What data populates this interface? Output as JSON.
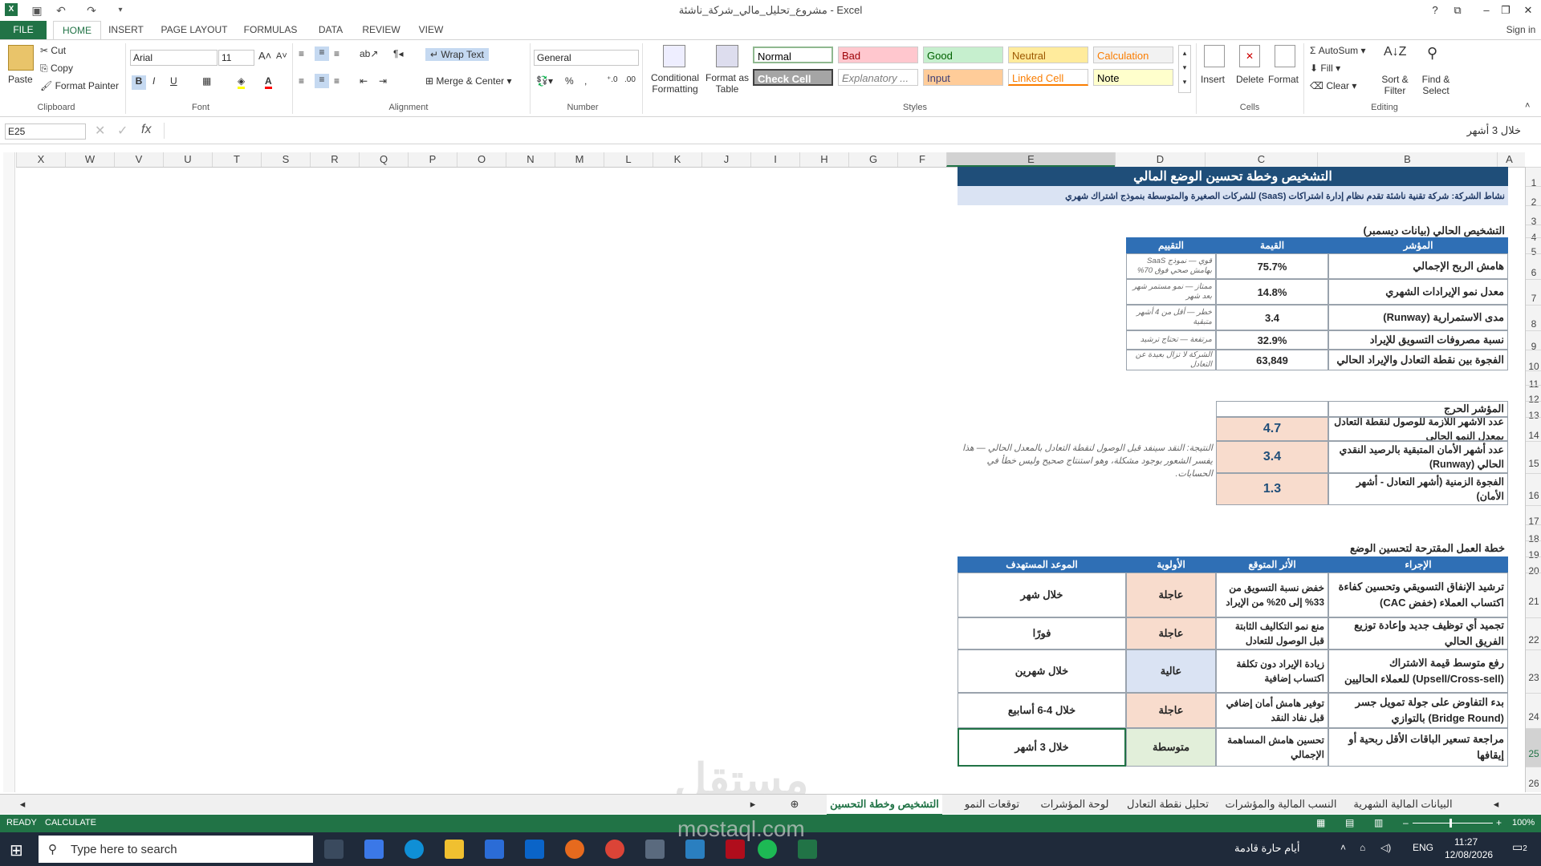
{
  "window": {
    "title": "مشروع_تحليل_مالي_شركة_ناشئة - Excel",
    "help": "?",
    "sign_in": "Sign in"
  },
  "ribbon_tabs": [
    "FILE",
    "HOME",
    "INSERT",
    "PAGE LAYOUT",
    "FORMULAS",
    "DATA",
    "REVIEW",
    "VIEW"
  ],
  "clipboard": {
    "paste": "Paste",
    "cut": "Cut",
    "copy": "Copy",
    "format_painter": "Format Painter",
    "label": "Clipboard"
  },
  "font": {
    "name": "Arial",
    "size": "11",
    "label": "Font"
  },
  "alignment": {
    "wrap": "Wrap Text",
    "merge": "Merge & Center",
    "label": "Alignment"
  },
  "number": {
    "format": "General",
    "label": "Number"
  },
  "styles": {
    "conditional": "Conditional Formatting",
    "format_table": "Format as Table",
    "label": "Styles",
    "cells": [
      {
        "name": "Normal",
        "bg": "#ffffff",
        "fg": "#000000"
      },
      {
        "name": "Bad",
        "bg": "#ffc7ce",
        "fg": "#9c0006"
      },
      {
        "name": "Good",
        "bg": "#c6efce",
        "fg": "#006100"
      },
      {
        "name": "Neutral",
        "bg": "#ffeb9c",
        "fg": "#9c5700"
      },
      {
        "name": "Calculation",
        "bg": "#f2f2f2",
        "fg": "#fa7d00"
      },
      {
        "name": "Check Cell",
        "bg": "#a5a5a5",
        "fg": "#ffffff"
      },
      {
        "name": "Explanatory ...",
        "bg": "#ffffff",
        "fg": "#7f7f7f"
      },
      {
        "name": "Input",
        "bg": "#ffcc99",
        "fg": "#3f3f76"
      },
      {
        "name": "Linked Cell",
        "bg": "#ffffff",
        "fg": "#fa7d00"
      },
      {
        "name": "Note",
        "bg": "#ffffcc",
        "fg": "#000000"
      }
    ]
  },
  "cells_group": {
    "insert": "Insert",
    "delete": "Delete",
    "format": "Format",
    "label": "Cells"
  },
  "editing": {
    "autosum": "AutoSum",
    "fill": "Fill",
    "clear": "Clear",
    "sort": "Sort & Filter",
    "find": "Find & Select",
    "label": "Editing"
  },
  "formula_bar": {
    "name_box": "E25",
    "fx": "fx",
    "content": "خلال 3 أشهر"
  },
  "columns": [
    "X",
    "W",
    "V",
    "U",
    "T",
    "S",
    "R",
    "Q",
    "P",
    "O",
    "N",
    "M",
    "L",
    "K",
    "J",
    "I",
    "H",
    "G",
    "F",
    "E",
    "D",
    "C",
    "B",
    "A"
  ],
  "rows": [
    "1",
    "2",
    "3",
    "4",
    "5",
    "6",
    "7",
    "8",
    "9",
    "10",
    "11",
    "12",
    "13",
    "14",
    "15",
    "16",
    "17",
    "18",
    "19",
    "20",
    "21",
    "22",
    "23",
    "24",
    "25",
    "26"
  ],
  "sheet": {
    "title": "التشخيص وخطة تحسين الوضع المالي",
    "activity": "نشاط الشركة: شركة تقنية ناشئة تقدم نظام إدارة اشتراكات (SaaS) للشركات الصغيرة والمتوسطة بنموذج اشتراك شهري",
    "diag_heading": "التشخيص الحالي (بيانات ديسمبر)",
    "diag_headers": [
      "المؤشر",
      "القيمة",
      "التقييم"
    ],
    "diag_rows": [
      {
        "indicator": "هامش الربح الإجمالي",
        "value": "75.7%",
        "assessment": "قوي — نموذج SaaS بهامش صحي فوق 70%"
      },
      {
        "indicator": "معدل نمو الإيرادات الشهري",
        "value": "14.8%",
        "assessment": "ممتاز — نمو مستمر شهر بعد شهر"
      },
      {
        "indicator": "مدى الاستمرارية (Runway)",
        "value": "3.4",
        "assessment": "خطر — أقل من 4 أشهر متبقية"
      },
      {
        "indicator": "نسبة مصروفات التسويق للإيراد",
        "value": "32.9%",
        "assessment": "مرتفعة — تحتاج ترشيد"
      },
      {
        "indicator": "الفجوة بين نقطة التعادل والإيراد الحالي",
        "value": "63,849",
        "assessment": "الشركة لا تزال بعيدة عن التعادل"
      }
    ],
    "critical_heading": "المؤشر الحرج",
    "critical_rows": [
      {
        "label": "عدد الأشهر اللازمة للوصول لنقطة التعادل بمعدل النمو الحالي",
        "value": "4.7"
      },
      {
        "label": "عدد أشهر الأمان المتبقية بالرصيد النقدي الحالي (Runway)",
        "value": "3.4"
      },
      {
        "label": "الفجوة الزمنية (أشهر التعادل - أشهر الأمان)",
        "value": "1.3"
      }
    ],
    "critical_note": "النتيجة: النقد سينفد قبل الوصول لنقطة التعادل بالمعدل الحالي — هذا يفسر الشعور بوجود مشكلة، وهو استنتاج صحيح وليس خطأ في الحسابات.",
    "plan_heading": "خطة العمل المقترحة لتحسين الوضع",
    "plan_headers": [
      "الإجراء",
      "الأثر المتوقع",
      "الأولوية",
      "الموعد المستهدف"
    ],
    "plan_rows": [
      {
        "action": "ترشيد الإنفاق التسويقي وتحسين كفاءة اكتساب العملاء (خفض CAC)",
        "impact": "خفض نسبة التسويق من 33% إلى 20% من الإيراد",
        "priority": "عاجلة",
        "deadline": "خلال شهر",
        "pcolor": "#f8dccd"
      },
      {
        "action": "تجميد أي توظيف جديد وإعادة توزيع الفريق الحالي",
        "impact": "منع نمو التكاليف الثابتة قبل الوصول للتعادل",
        "priority": "عاجلة",
        "deadline": "فورًا",
        "pcolor": "#f8dccd"
      },
      {
        "action": "رفع متوسط قيمة الاشتراك (Upsell/Cross-sell) للعملاء الحاليين",
        "impact": "زيادة الإيراد دون تكلفة اكتساب إضافية",
        "priority": "عالية",
        "deadline": "خلال شهرين",
        "pcolor": "#dae3f3"
      },
      {
        "action": "بدء التفاوض على جولة تمويل جسر (Bridge Round) بالتوازي",
        "impact": "توفير هامش أمان إضافي قبل نفاد النقد",
        "priority": "عاجلة",
        "deadline": "خلال 4-6 أسابيع",
        "pcolor": "#f8dccd"
      },
      {
        "action": "مراجعة تسعير الباقات الأقل ربحية أو إيقافها",
        "impact": "تحسين هامش المساهمة الإجمالي",
        "priority": "متوسطة",
        "deadline": "خلال 3 أشهر",
        "pcolor": "#e2efda"
      }
    ]
  },
  "sheet_tabs": [
    "التشخيص وخطة التحسين",
    "توقعات النمو",
    "لوحة المؤشرات",
    "تحليل نقطة التعادل",
    "النسب المالية والمؤشرات",
    "البيانات المالية الشهرية"
  ],
  "status": {
    "ready": "READY",
    "calculate": "CALCULATE",
    "zoom": "100%"
  },
  "taskbar": {
    "search_placeholder": "Type here to search",
    "weather": "أيام حارة قادمة",
    "lang": "ENG",
    "time": "11:27",
    "date": "12/08/2026",
    "notif": "2"
  },
  "watermark": {
    "brand": "مستقل",
    "url": "mostaql.com"
  }
}
